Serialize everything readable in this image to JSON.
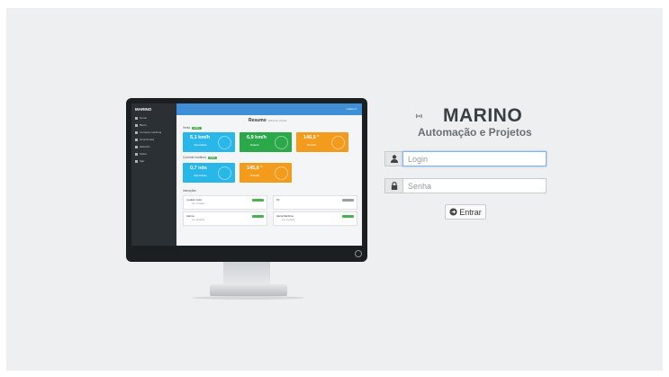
{
  "brand": {
    "name": "MARINO",
    "tagline": "Automação e Projetos",
    "logo_icon": "radio-waves-icon"
  },
  "form": {
    "login_placeholder": "Login",
    "password_placeholder": "Senha",
    "login_icon": "user-icon",
    "password_icon": "lock-icon",
    "submit_label": "Entrar",
    "submit_icon": "arrow-circle-icon"
  },
  "preview": {
    "brand": "MARINO",
    "nav": [
      "Home",
      "Barco",
      "Corrente marítima",
      "Ocorrências",
      "Histórico",
      "Sobre",
      "Sair"
    ],
    "user": "marino ▾",
    "title": "Resumo",
    "subtitle": "Painel de controle",
    "wind_section": "Vento",
    "current_section": "Corrente marítima",
    "tag": "online",
    "wind_cards": [
      {
        "value": "5,1 km/h",
        "label": "Velocidade",
        "color": "#29b6e8"
      },
      {
        "value": "6,9 km/h",
        "label": "Rajada",
        "color": "#2aa84a"
      },
      {
        "value": "146,5 °",
        "label": "Direção",
        "color": "#f29b1d"
      }
    ],
    "current_cards": [
      {
        "value": "0,7 nós",
        "label": "Velocidade",
        "color": "#29b6e8"
      },
      {
        "value": "145,6 °",
        "label": "Direção",
        "color": "#f29b1d"
      }
    ],
    "interactions_section": "Interações",
    "interactions": [
      {
        "title": "medidor.maré",
        "sub": "sem medição",
        "badge": "#4caf50"
      },
      {
        "title": "P2",
        "sub": "",
        "badge": "#9e9e9e"
      },
      {
        "title": "Alarme",
        "sub": "sem ativação",
        "badge": "#4caf50"
      },
      {
        "title": "Alerta.Marítimo",
        "sub": "sem medição",
        "badge": "#4caf50"
      }
    ]
  }
}
